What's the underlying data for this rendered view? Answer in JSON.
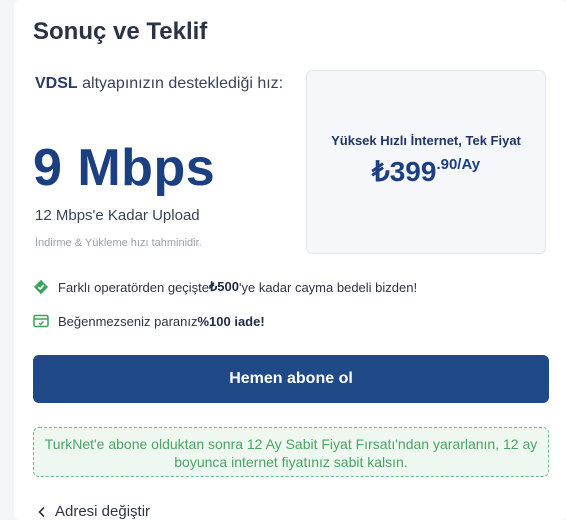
{
  "section": {
    "title": "Sonuç ve Teklif"
  },
  "speed": {
    "tech": "VDSL",
    "desc_rest": " altyapınızın desteklediği hız:",
    "value": "9 Mbps",
    "upload": "12 Mbps'e Kadar Upload",
    "note": "İndirme & Yükleme hızı tahminidir."
  },
  "offer": {
    "label": "Yüksek Hızlı İnternet, Tek Fiyat",
    "price_main": "₺399",
    "price_sup": ".90/Ay"
  },
  "perks": [
    {
      "icon": "diamond-icon",
      "pre": "Farklı operatörden geçişte ",
      "bold": "₺500",
      "post": "'ye kadar cayma bedeli bizden!"
    },
    {
      "icon": "card-check-icon",
      "pre": "Beğenmezseniz paranız ",
      "bold": "%100 iade!",
      "post": ""
    }
  ],
  "cta": {
    "label": "Hemen abone ol"
  },
  "info": {
    "text": "TurkNet'e abone olduktan sonra 12 Ay Sabit Fiyat Fırsatı'ndan yararlanın, 12 ay boyunca internet fiyatınız sabit kalsın."
  },
  "back": {
    "label": "Adresi değiştir"
  },
  "colors": {
    "primary": "#1f4a87",
    "speed": "#1c3f80",
    "green": "#4aa464",
    "perk_icon": "#3aa35a"
  }
}
